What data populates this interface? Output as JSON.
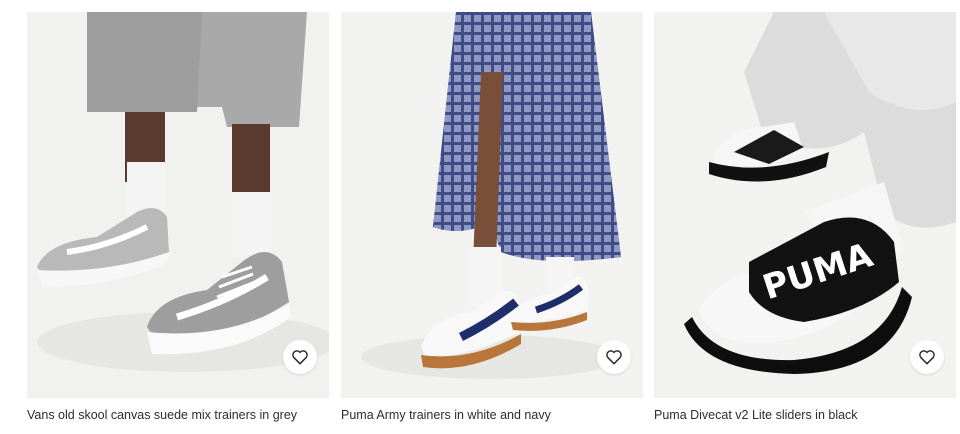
{
  "products": [
    {
      "title": "Vans old skool canvas suede mix trainers in grey",
      "image": "grey-suede-trainers-photo",
      "favourite_icon": "heart-outline-icon"
    },
    {
      "title": "Puma Army trainers in white and navy",
      "image": "white-navy-gum-trainers-photo",
      "favourite_icon": "heart-outline-icon"
    },
    {
      "title": "Puma Divecat v2 Lite sliders in black",
      "image": "black-sliders-photo",
      "logo_text": "PUMA",
      "favourite_icon": "heart-outline-icon"
    }
  ],
  "colors": {
    "text": "#2d2d2d",
    "image_bg": "#eeeeec",
    "button_bg": "#ffffff"
  }
}
